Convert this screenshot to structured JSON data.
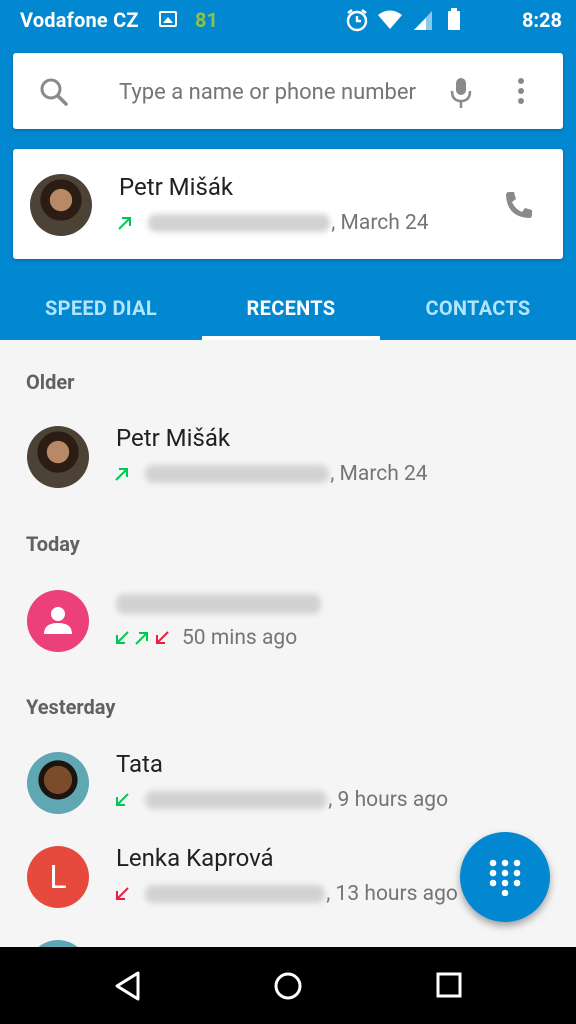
{
  "status_bar": {
    "carrier": "Vodafone CZ",
    "notification_count": "81",
    "time": "8:28"
  },
  "search": {
    "placeholder": "Type a name or phone number"
  },
  "featured_contact": {
    "name": "Petr Mišák",
    "call_type": "outgoing",
    "date": ", March 24"
  },
  "tabs": [
    {
      "label": "SPEED DIAL",
      "active": false
    },
    {
      "label": "RECENTS",
      "active": true
    },
    {
      "label": "CONTACTS",
      "active": false
    }
  ],
  "sections": {
    "older": "Older",
    "today": "Today",
    "yesterday": "Yesterday"
  },
  "recents": [
    {
      "name": "Petr Mišák",
      "detail": ", March 24",
      "calls": [
        "outgoing"
      ]
    },
    {
      "name": "",
      "detail": "50 mins ago",
      "calls": [
        "incoming",
        "outgoing",
        "missed"
      ]
    },
    {
      "name": "Tata",
      "detail": ", 9 hours ago",
      "calls": [
        "incoming"
      ]
    },
    {
      "name": "Lenka Kaprová",
      "avatar_letter": "L",
      "detail": ", 13 hours ago",
      "calls": [
        "missed"
      ]
    }
  ],
  "colors": {
    "primary": "#0288d1",
    "incoming": "#00c853",
    "outgoing": "#00c853",
    "missed": "#ec1c43",
    "tab_inactive": "#b3e5fc"
  },
  "icons": [
    "search-icon",
    "microphone-icon",
    "more-vert-icon",
    "phone-icon",
    "dialpad-icon",
    "back-icon",
    "home-icon",
    "recents-icon"
  ]
}
